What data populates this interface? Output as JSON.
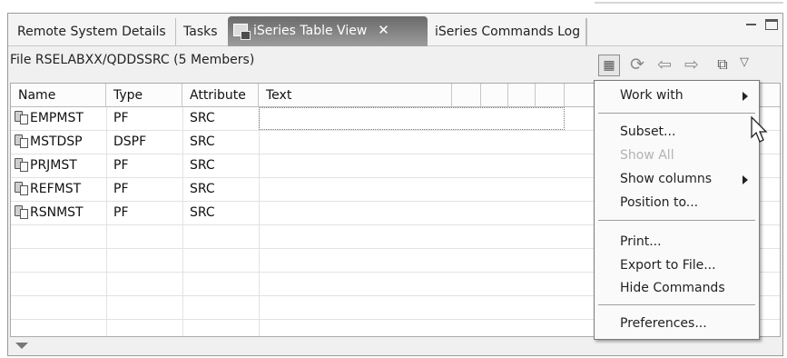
{
  "tabs": [
    {
      "label": "Remote System Details"
    },
    {
      "label": "Tasks"
    },
    {
      "label": "iSeries Table View",
      "active": true
    },
    {
      "label": "iSeries Commands Log"
    }
  ],
  "view": {
    "title": "File RSELABXX/QDDSSRC (5 Members)"
  },
  "toolbar": {
    "icons": [
      "table-view-icon",
      "refresh-icon",
      "back-arrow-icon",
      "forward-arrow-icon",
      "command-icon",
      "view-menu-chevron-icon"
    ]
  },
  "table": {
    "columns": [
      "Name",
      "Type",
      "Attribute",
      "Text",
      "",
      "",
      "",
      "",
      ""
    ],
    "rows": [
      {
        "name": "EMPMST",
        "type": "PF",
        "attribute": "SRC"
      },
      {
        "name": "MSTDSP",
        "type": "DSPF",
        "attribute": "SRC"
      },
      {
        "name": "PRJMST",
        "type": "PF",
        "attribute": "SRC"
      },
      {
        "name": "REFMST",
        "type": "PF",
        "attribute": "SRC"
      },
      {
        "name": "RSNMST",
        "type": "PF",
        "attribute": "SRC"
      }
    ]
  },
  "menu": {
    "work_with": "Work with",
    "subset": "Subset...",
    "show_all": "Show All",
    "show_columns": "Show columns",
    "position_to": "Position to...",
    "print": "Print...",
    "export": "Export to File...",
    "hide_commands": "Hide Commands",
    "preferences": "Preferences..."
  }
}
